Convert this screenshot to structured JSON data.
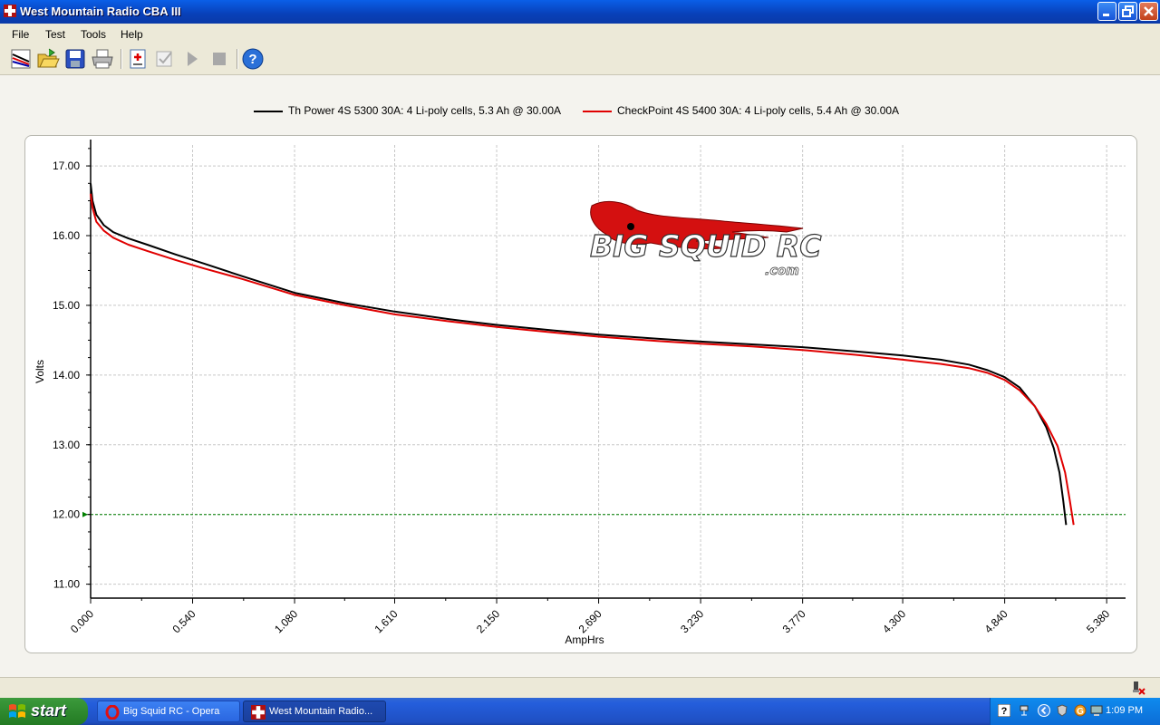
{
  "window": {
    "title": "West Mountain Radio CBA III"
  },
  "menu": {
    "items": [
      "File",
      "Test",
      "Tools",
      "Help"
    ]
  },
  "toolbar": {
    "buttons": [
      "new-test-icon",
      "open-folder-icon",
      "save-icon",
      "print-icon",
      "add-test-icon",
      "checkmark-icon",
      "play-icon",
      "stop-icon",
      "help-icon"
    ]
  },
  "chart_data": {
    "type": "line",
    "xlabel": "AmpHrs",
    "ylabel": "Volts",
    "xlim": [
      0,
      5.48
    ],
    "ylim": [
      10.8,
      17.3
    ],
    "x_ticks": [
      "0.000",
      "0.540",
      "1.080",
      "1.610",
      "2.150",
      "2.690",
      "3.230",
      "3.770",
      "4.300",
      "4.840",
      "5.380"
    ],
    "y_ticks": [
      "17.00",
      "16.00",
      "15.00",
      "14.00",
      "13.00",
      "12.00",
      "11.00"
    ],
    "cutoff_line": {
      "y": 12.0,
      "color": "#008000"
    },
    "grid": true,
    "legend_position": "top-center",
    "series": [
      {
        "name": "Th Power 4S 5300 30A: 4 Li-poly cells, 5.3 Ah @ 30.00A",
        "color": "#000000",
        "points": [
          [
            0.0,
            16.75
          ],
          [
            0.01,
            16.5
          ],
          [
            0.03,
            16.3
          ],
          [
            0.07,
            16.15
          ],
          [
            0.12,
            16.05
          ],
          [
            0.2,
            15.96
          ],
          [
            0.3,
            15.87
          ],
          [
            0.45,
            15.73
          ],
          [
            0.6,
            15.6
          ],
          [
            0.8,
            15.42
          ],
          [
            1.08,
            15.18
          ],
          [
            1.35,
            15.03
          ],
          [
            1.61,
            14.91
          ],
          [
            1.9,
            14.8
          ],
          [
            2.15,
            14.72
          ],
          [
            2.45,
            14.64
          ],
          [
            2.69,
            14.58
          ],
          [
            3.0,
            14.52
          ],
          [
            3.23,
            14.48
          ],
          [
            3.5,
            14.44
          ],
          [
            3.77,
            14.4
          ],
          [
            4.05,
            14.34
          ],
          [
            4.3,
            14.28
          ],
          [
            4.5,
            14.22
          ],
          [
            4.65,
            14.15
          ],
          [
            4.75,
            14.07
          ],
          [
            4.84,
            13.97
          ],
          [
            4.92,
            13.82
          ],
          [
            5.0,
            13.55
          ],
          [
            5.06,
            13.25
          ],
          [
            5.1,
            12.95
          ],
          [
            5.13,
            12.6
          ],
          [
            5.15,
            12.2
          ],
          [
            5.165,
            11.85
          ]
        ]
      },
      {
        "name": "CheckPoint 4S 5400 30A: 4 Li-poly cells, 5.4 Ah @ 30.00A",
        "color": "#E00000",
        "points": [
          [
            0.0,
            16.6
          ],
          [
            0.01,
            16.4
          ],
          [
            0.03,
            16.2
          ],
          [
            0.07,
            16.07
          ],
          [
            0.12,
            15.97
          ],
          [
            0.2,
            15.87
          ],
          [
            0.3,
            15.78
          ],
          [
            0.45,
            15.65
          ],
          [
            0.6,
            15.53
          ],
          [
            0.8,
            15.38
          ],
          [
            1.08,
            15.15
          ],
          [
            1.35,
            15.0
          ],
          [
            1.61,
            14.87
          ],
          [
            1.9,
            14.77
          ],
          [
            2.15,
            14.69
          ],
          [
            2.45,
            14.61
          ],
          [
            2.69,
            14.55
          ],
          [
            3.0,
            14.49
          ],
          [
            3.23,
            14.45
          ],
          [
            3.5,
            14.41
          ],
          [
            3.77,
            14.36
          ],
          [
            4.05,
            14.29
          ],
          [
            4.3,
            14.22
          ],
          [
            4.5,
            14.16
          ],
          [
            4.65,
            14.1
          ],
          [
            4.75,
            14.03
          ],
          [
            4.84,
            13.93
          ],
          [
            4.92,
            13.78
          ],
          [
            5.0,
            13.55
          ],
          [
            5.06,
            13.3
          ],
          [
            5.12,
            12.98
          ],
          [
            5.16,
            12.6
          ],
          [
            5.185,
            12.2
          ],
          [
            5.205,
            11.85
          ]
        ]
      }
    ],
    "watermark": "BIG SQUID RC .com"
  },
  "taskbar": {
    "start_label": "start",
    "tasks": [
      "Big Squid RC - Opera",
      "West Mountain Radio..."
    ],
    "clock": "1:09 PM"
  }
}
